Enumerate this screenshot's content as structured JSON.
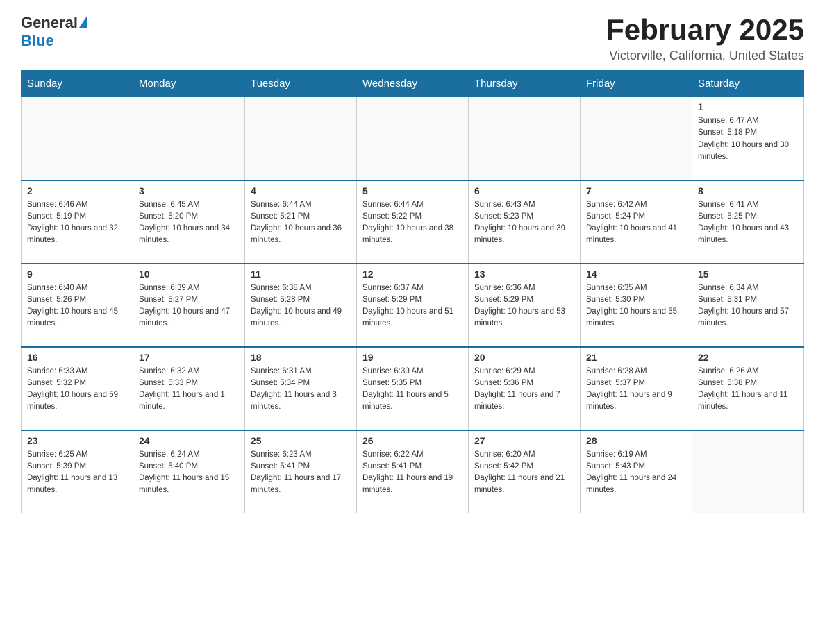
{
  "header": {
    "logo_general": "General",
    "logo_blue": "Blue",
    "title": "February 2025",
    "location": "Victorville, California, United States"
  },
  "days_of_week": [
    "Sunday",
    "Monday",
    "Tuesday",
    "Wednesday",
    "Thursday",
    "Friday",
    "Saturday"
  ],
  "weeks": [
    [
      {
        "day": "",
        "info": ""
      },
      {
        "day": "",
        "info": ""
      },
      {
        "day": "",
        "info": ""
      },
      {
        "day": "",
        "info": ""
      },
      {
        "day": "",
        "info": ""
      },
      {
        "day": "",
        "info": ""
      },
      {
        "day": "1",
        "info": "Sunrise: 6:47 AM\nSunset: 5:18 PM\nDaylight: 10 hours and 30 minutes."
      }
    ],
    [
      {
        "day": "2",
        "info": "Sunrise: 6:46 AM\nSunset: 5:19 PM\nDaylight: 10 hours and 32 minutes."
      },
      {
        "day": "3",
        "info": "Sunrise: 6:45 AM\nSunset: 5:20 PM\nDaylight: 10 hours and 34 minutes."
      },
      {
        "day": "4",
        "info": "Sunrise: 6:44 AM\nSunset: 5:21 PM\nDaylight: 10 hours and 36 minutes."
      },
      {
        "day": "5",
        "info": "Sunrise: 6:44 AM\nSunset: 5:22 PM\nDaylight: 10 hours and 38 minutes."
      },
      {
        "day": "6",
        "info": "Sunrise: 6:43 AM\nSunset: 5:23 PM\nDaylight: 10 hours and 39 minutes."
      },
      {
        "day": "7",
        "info": "Sunrise: 6:42 AM\nSunset: 5:24 PM\nDaylight: 10 hours and 41 minutes."
      },
      {
        "day": "8",
        "info": "Sunrise: 6:41 AM\nSunset: 5:25 PM\nDaylight: 10 hours and 43 minutes."
      }
    ],
    [
      {
        "day": "9",
        "info": "Sunrise: 6:40 AM\nSunset: 5:26 PM\nDaylight: 10 hours and 45 minutes."
      },
      {
        "day": "10",
        "info": "Sunrise: 6:39 AM\nSunset: 5:27 PM\nDaylight: 10 hours and 47 minutes."
      },
      {
        "day": "11",
        "info": "Sunrise: 6:38 AM\nSunset: 5:28 PM\nDaylight: 10 hours and 49 minutes."
      },
      {
        "day": "12",
        "info": "Sunrise: 6:37 AM\nSunset: 5:29 PM\nDaylight: 10 hours and 51 minutes."
      },
      {
        "day": "13",
        "info": "Sunrise: 6:36 AM\nSunset: 5:29 PM\nDaylight: 10 hours and 53 minutes."
      },
      {
        "day": "14",
        "info": "Sunrise: 6:35 AM\nSunset: 5:30 PM\nDaylight: 10 hours and 55 minutes."
      },
      {
        "day": "15",
        "info": "Sunrise: 6:34 AM\nSunset: 5:31 PM\nDaylight: 10 hours and 57 minutes."
      }
    ],
    [
      {
        "day": "16",
        "info": "Sunrise: 6:33 AM\nSunset: 5:32 PM\nDaylight: 10 hours and 59 minutes."
      },
      {
        "day": "17",
        "info": "Sunrise: 6:32 AM\nSunset: 5:33 PM\nDaylight: 11 hours and 1 minute."
      },
      {
        "day": "18",
        "info": "Sunrise: 6:31 AM\nSunset: 5:34 PM\nDaylight: 11 hours and 3 minutes."
      },
      {
        "day": "19",
        "info": "Sunrise: 6:30 AM\nSunset: 5:35 PM\nDaylight: 11 hours and 5 minutes."
      },
      {
        "day": "20",
        "info": "Sunrise: 6:29 AM\nSunset: 5:36 PM\nDaylight: 11 hours and 7 minutes."
      },
      {
        "day": "21",
        "info": "Sunrise: 6:28 AM\nSunset: 5:37 PM\nDaylight: 11 hours and 9 minutes."
      },
      {
        "day": "22",
        "info": "Sunrise: 6:26 AM\nSunset: 5:38 PM\nDaylight: 11 hours and 11 minutes."
      }
    ],
    [
      {
        "day": "23",
        "info": "Sunrise: 6:25 AM\nSunset: 5:39 PM\nDaylight: 11 hours and 13 minutes."
      },
      {
        "day": "24",
        "info": "Sunrise: 6:24 AM\nSunset: 5:40 PM\nDaylight: 11 hours and 15 minutes."
      },
      {
        "day": "25",
        "info": "Sunrise: 6:23 AM\nSunset: 5:41 PM\nDaylight: 11 hours and 17 minutes."
      },
      {
        "day": "26",
        "info": "Sunrise: 6:22 AM\nSunset: 5:41 PM\nDaylight: 11 hours and 19 minutes."
      },
      {
        "day": "27",
        "info": "Sunrise: 6:20 AM\nSunset: 5:42 PM\nDaylight: 11 hours and 21 minutes."
      },
      {
        "day": "28",
        "info": "Sunrise: 6:19 AM\nSunset: 5:43 PM\nDaylight: 11 hours and 24 minutes."
      },
      {
        "day": "",
        "info": ""
      }
    ]
  ]
}
